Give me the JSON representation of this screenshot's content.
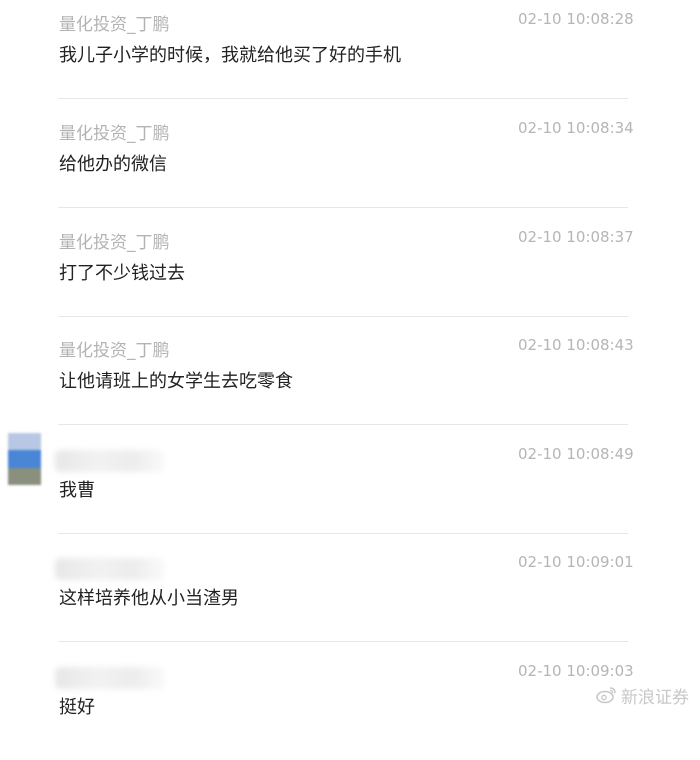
{
  "messages": [
    {
      "sender": "量化投资_丁鹏",
      "time": "02-10 10:08:28",
      "text": "我儿子小学的时候，我就给他买了好的手机"
    },
    {
      "sender": "量化投资_丁鹏",
      "time": "02-10 10:08:34",
      "text": "给他办的微信"
    },
    {
      "sender": "量化投资_丁鹏",
      "time": "02-10 10:08:37",
      "text": "打了不少钱过去"
    },
    {
      "sender": "量化投资_丁鹏",
      "time": "02-10 10:08:43",
      "text": "让他请班上的女学生去吃零食"
    },
    {
      "sender": "",
      "time": "02-10 10:08:49",
      "text": "我曹"
    },
    {
      "sender": "",
      "time": "02-10 10:09:01",
      "text": "这样培养他从小当渣男"
    },
    {
      "sender": "",
      "time": "02-10 10:09:03",
      "text": "挺好"
    }
  ],
  "watermark": {
    "text": "新浪证券",
    "icon": "weibo-icon"
  },
  "colors": {
    "sender": "#b3b3b3",
    "time": "#b5b5b5",
    "text": "#222222",
    "divider": "#e7e7e7"
  }
}
